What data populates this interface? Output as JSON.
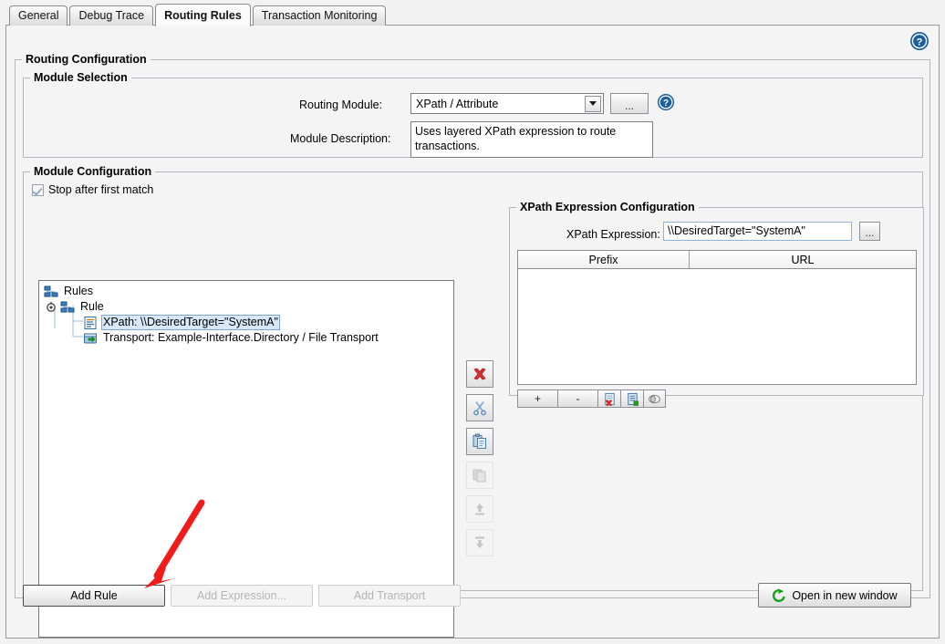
{
  "tabs": [
    {
      "label": "General",
      "selected": false
    },
    {
      "label": "Debug Trace",
      "selected": false
    },
    {
      "label": "Routing Rules",
      "selected": true
    },
    {
      "label": "Transaction Monitoring",
      "selected": false
    }
  ],
  "help_icon": "help-icon",
  "routing_configuration": {
    "title": "Routing Configuration",
    "module_selection": {
      "title": "Module Selection",
      "routing_module_label": "Routing Module:",
      "routing_module_value": "XPath / Attribute",
      "routing_module_options": [
        "XPath / Attribute"
      ],
      "browse_label": "...",
      "help_icon": "help-icon",
      "module_description_label": "Module Description:",
      "module_description_value": "Uses layered XPath expression to route transactions."
    },
    "module_configuration": {
      "title": "Module Configuration",
      "stop_after_first_match_label": "Stop after first match",
      "stop_after_first_match_checked": true,
      "tree": [
        {
          "label": "Rules",
          "icon": "rules-node-icon",
          "indent": 0,
          "selected": false,
          "expander": false
        },
        {
          "label": "Rule",
          "icon": "rule-node-icon",
          "indent": 1,
          "selected": false,
          "expander": true
        },
        {
          "label": "XPath: \\\\DesiredTarget=\"SystemA\"",
          "icon": "xpath-node-icon",
          "indent": 2,
          "selected": true,
          "expander": false
        },
        {
          "label": "Transport: Example-Interface.Directory / File Transport",
          "icon": "transport-node-icon",
          "indent": 2,
          "selected": false,
          "expander": false
        }
      ],
      "tool_buttons": [
        {
          "name": "delete-button",
          "icon": "red-x-icon",
          "enabled": true
        },
        {
          "name": "cut-button",
          "icon": "scissors-icon",
          "enabled": true
        },
        {
          "name": "paste-button",
          "icon": "paste-icon",
          "enabled": true
        },
        {
          "name": "copy-button",
          "icon": "copy-icon",
          "enabled": false
        },
        {
          "name": "move-up-button",
          "icon": "arrow-up-icon",
          "enabled": false
        },
        {
          "name": "move-down-button",
          "icon": "arrow-down-icon",
          "enabled": false
        }
      ],
      "xpath_expression_configuration": {
        "title": "XPath Expression Configuration",
        "expression_label": "XPath Expression:",
        "expression_value": "\\\\DesiredTarget=\"SystemA\"",
        "browse_label": "...",
        "table": {
          "columns": [
            "Prefix",
            "URL"
          ],
          "rows": []
        },
        "toolbar": [
          {
            "name": "add-namespace-button",
            "label": "+",
            "icon": null
          },
          {
            "name": "remove-namespace-button",
            "label": "-",
            "icon": null
          },
          {
            "name": "clear-namespaces-button",
            "label": "",
            "icon": "document-delete-icon"
          },
          {
            "name": "import-namespaces-button",
            "label": "",
            "icon": "document-add-icon"
          },
          {
            "name": "toggle-namespaces-button",
            "label": "",
            "icon": "toggle-icon"
          }
        ]
      }
    }
  },
  "footer": {
    "add_rule_label": "Add Rule",
    "add_rule_enabled": true,
    "add_expression_label": "Add Expression...",
    "add_expression_enabled": false,
    "add_transport_label": "Add Transport",
    "add_transport_enabled": false,
    "open_new_window_label": "Open in new window",
    "open_new_window_icon": "refresh-arrow-icon"
  },
  "annotation": {
    "arrow_color": "#f01b1b",
    "points_to": "add-rule-button"
  },
  "colors": {
    "selection_bg": "#d8e8f8",
    "selection_border": "#7aa7d8",
    "panel_bg": "#f4f4f4",
    "accent_blue": "#1d5f9e",
    "accent_green": "#17a017",
    "accent_red": "#d83030"
  }
}
